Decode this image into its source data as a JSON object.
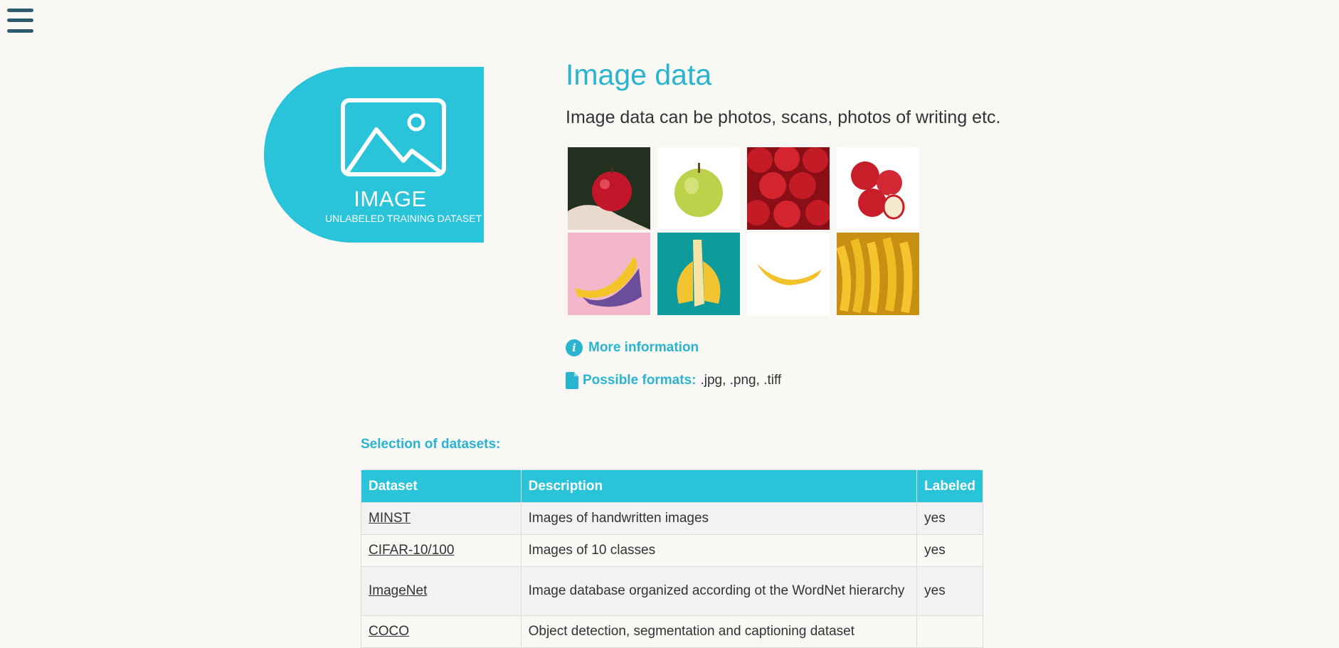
{
  "badge": {
    "title": "IMAGE",
    "subtitle": "UNLABELED TRAINING DATASET"
  },
  "page": {
    "title": "Image data",
    "intro": "Image data can be photos, scans, photos of writing etc."
  },
  "gallery": [
    {
      "subject": "apple in hand"
    },
    {
      "subject": "green apple"
    },
    {
      "subject": "pile of red apples"
    },
    {
      "subject": "cut red apples"
    },
    {
      "subject": "banana on pink"
    },
    {
      "subject": "peeled banana on teal"
    },
    {
      "subject": "single banana"
    },
    {
      "subject": "banana bunches"
    }
  ],
  "more_info": {
    "label": "More information",
    "icon": "info-icon"
  },
  "formats": {
    "label": "Possible formats:",
    "value": ".jpg, .png, .tiff",
    "icon": "file-icon"
  },
  "datasets": {
    "heading": "Selection of datasets:",
    "columns": [
      "Dataset",
      "Description",
      "Labeled"
    ],
    "rows": [
      {
        "name": "MINST",
        "description": "Images of handwritten images",
        "labeled": "yes"
      },
      {
        "name": "CIFAR-10/100",
        "description": "Images of 10 classes",
        "labeled": "yes"
      },
      {
        "name": "ImageNet",
        "description": "Image database organized according ot the WordNet hierarchy",
        "labeled": "yes"
      },
      {
        "name": "COCO",
        "description": "Object detection, segmentation and captioning dataset",
        "labeled": ""
      }
    ]
  },
  "colors": {
    "accent": "#29c4da",
    "accent_text": "#29b4cf",
    "menu": "#2d5d6c",
    "background": "#faf8f5"
  }
}
